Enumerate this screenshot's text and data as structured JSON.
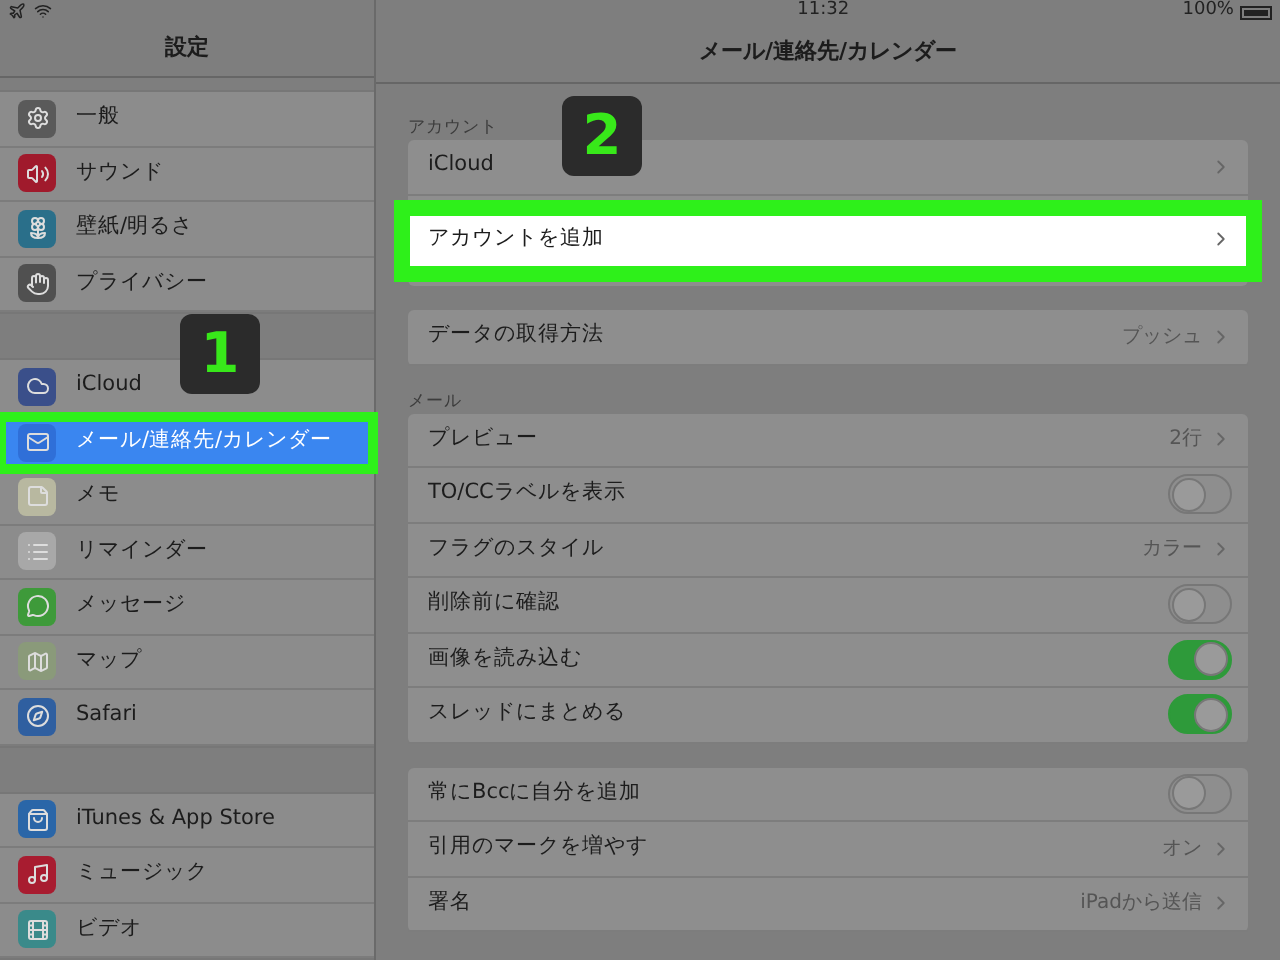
{
  "status_bar": {
    "time": "11:32",
    "battery": "100%"
  },
  "sidebar": {
    "title": "設定",
    "groups": [
      {
        "items": [
          {
            "label": "一般",
            "kind": "gear",
            "color": "#5a5a5a",
            "selected": false,
            "highlighted": false
          },
          {
            "label": "サウンド",
            "kind": "speaker",
            "color": "#a01a2c",
            "selected": false,
            "highlighted": false
          },
          {
            "label": "壁紙/明るさ",
            "kind": "flower",
            "color": "#2a6f8a",
            "selected": false,
            "highlighted": false
          },
          {
            "label": "プライバシー",
            "kind": "hand",
            "color": "#505050",
            "selected": false,
            "highlighted": false
          }
        ]
      },
      {
        "items": [
          {
            "label": "iCloud",
            "kind": "cloud",
            "color": "#3a4f8a",
            "selected": false,
            "highlighted": false
          },
          {
            "label": "メール/連絡先/カレンダー",
            "kind": "mail",
            "color": "#2f6fd8",
            "selected": true,
            "highlighted": true
          },
          {
            "label": "メモ",
            "kind": "notes",
            "color": "#b8b8a0",
            "selected": false,
            "highlighted": false
          },
          {
            "label": "リマインダー",
            "kind": "list",
            "color": "#a8a8a8",
            "selected": false,
            "highlighted": false
          },
          {
            "label": "メッセージ",
            "kind": "bubble",
            "color": "#3e9a3a",
            "selected": false,
            "highlighted": false
          },
          {
            "label": "マップ",
            "kind": "map",
            "color": "#8a9a7a",
            "selected": false,
            "highlighted": false
          },
          {
            "label": "Safari",
            "kind": "compass",
            "color": "#2f5fa0",
            "selected": false,
            "highlighted": false
          }
        ]
      },
      {
        "items": [
          {
            "label": "iTunes & App Store",
            "kind": "store",
            "color": "#2a66a8",
            "selected": false,
            "highlighted": false
          },
          {
            "label": "ミュージック",
            "kind": "music",
            "color": "#a81c30",
            "selected": false,
            "highlighted": false
          },
          {
            "label": "ビデオ",
            "kind": "film",
            "color": "#3a8a8a",
            "selected": false,
            "highlighted": false
          }
        ]
      }
    ]
  },
  "detail": {
    "title": "メール/連絡先/カレンダー",
    "sections": [
      {
        "header": "アカウント",
        "rows": [
          {
            "kind": "link",
            "label": "iCloud",
            "highlighted": false
          },
          {
            "kind": "link",
            "label": "アカウントを追加",
            "highlighted": true
          }
        ]
      },
      {
        "rows": [
          {
            "kind": "link",
            "label": "データの取得方法",
            "value": "プッシュ",
            "highlighted": false
          }
        ]
      },
      {
        "header": "メール",
        "rows": [
          {
            "kind": "link",
            "label": "プレビュー",
            "value": "2行",
            "highlighted": false
          },
          {
            "kind": "toggle",
            "label": "TO/CCラベルを表示",
            "on": false
          },
          {
            "kind": "link",
            "label": "フラグのスタイル",
            "value": "カラー",
            "highlighted": false
          },
          {
            "kind": "toggle",
            "label": "削除前に確認",
            "on": false
          },
          {
            "kind": "toggle",
            "label": "画像を読み込む",
            "on": true
          },
          {
            "kind": "toggle",
            "label": "スレッドにまとめる",
            "on": true
          }
        ]
      },
      {
        "rows": [
          {
            "kind": "toggle",
            "label": "常にBccに自分を追加",
            "on": false
          },
          {
            "kind": "link",
            "label": "引用のマークを増やす",
            "value": "オン",
            "highlighted": false
          },
          {
            "kind": "link",
            "label": "署名",
            "value": "iPadから送信",
            "highlighted": false
          }
        ]
      }
    ]
  },
  "callouts": [
    "1",
    "2"
  ]
}
